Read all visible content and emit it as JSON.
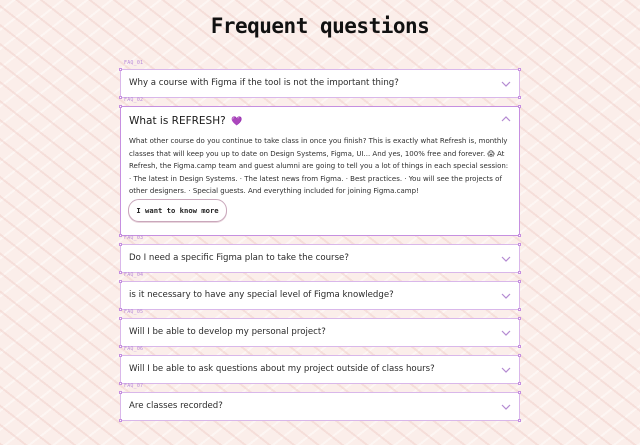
{
  "page": {
    "title": "Frequent questions"
  },
  "faqs": [
    {
      "tag": "FAQ_01",
      "question": "Why a course with Figma if the tool is not the important thing?",
      "expanded": false
    },
    {
      "tag": "FAQ_02",
      "question": "What is REFRESH?",
      "emoji": "💜",
      "expanded": true,
      "answer": "What other course do you continue to take class in once you finish? This is exactly what Refresh is, monthly classes that will keep you up to date on Design Systems, Figma, UI... And yes, 100% free and forever. 😱 At Refresh, the Figma.camp team and guest alumni are going to tell you a lot of things in each special session: · The latest in Design Systems. · The latest news from Figma. · Best practices. · You will see the projects of other designers. · Special guests. And everything included for joining Figma.camp!",
      "cta_label": "I want to know more"
    },
    {
      "tag": "FAQ_03",
      "question": "Do I need a specific Figma plan to take the course?",
      "expanded": false
    },
    {
      "tag": "FAQ_04",
      "question": "is it necessary to have any special level of Figma knowledge?",
      "expanded": false
    },
    {
      "tag": "FAQ_05",
      "question": "Will I be able to develop my personal project?",
      "expanded": false
    },
    {
      "tag": "FAQ_06",
      "question": "Will I be able to ask questions about my project outside of class hours?",
      "expanded": false
    },
    {
      "tag": "FAQ_07",
      "question": "Are classes recorded?",
      "expanded": false
    }
  ],
  "icons": {
    "collapsed": "chevron-down-icon",
    "expanded": "chevron-up-icon"
  },
  "colors": {
    "accent": "#c68fe0",
    "heart": "#9b3dd6",
    "background": "#fbeeea",
    "chevron": "#b48ad2"
  }
}
